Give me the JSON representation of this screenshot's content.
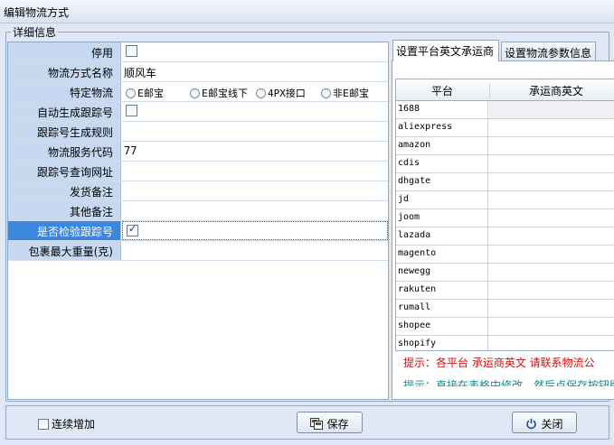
{
  "window": {
    "title": "编辑物流方式"
  },
  "group": {
    "legend": "详细信息"
  },
  "form": {
    "rows": [
      {
        "label": "停用"
      },
      {
        "label": "物流方式名称",
        "value": "顺风车"
      },
      {
        "label": "特定物流",
        "options": [
          "E邮宝",
          "E邮宝线下",
          "4PX接口",
          "非E邮宝"
        ]
      },
      {
        "label": "自动生成跟踪号"
      },
      {
        "label": "跟踪号生成规则",
        "value": ""
      },
      {
        "label": "物流服务代码",
        "value": "77"
      },
      {
        "label": "跟踪号查询网址",
        "value": ""
      },
      {
        "label": "发货备注",
        "value": ""
      },
      {
        "label": "其他备注",
        "value": ""
      },
      {
        "label": "是否检验跟踪号"
      },
      {
        "label": "包裹最大重量(克)",
        "value": ""
      }
    ]
  },
  "tabs": [
    {
      "label": "设置平台英文承运商",
      "active": true
    },
    {
      "label": "设置物流参数信息",
      "active": false
    }
  ],
  "grid": {
    "headers": [
      "平台",
      "承运商英文"
    ],
    "rows": [
      "1688",
      "aliexpress",
      "amazon",
      "cdis",
      "dhgate",
      "jd",
      "joom",
      "lazada",
      "magento",
      "newegg",
      "rakuten",
      "rumall",
      "shopee",
      "shopify"
    ]
  },
  "hints": {
    "red": "提示：各平台 承运商英文 请联系物流公",
    "teal": "提示：直接在表格中修改，然后点保存按钮即"
  },
  "footer": {
    "continuous_label": "连续增加",
    "save_label": "保存",
    "close_label": "关闭"
  },
  "colors": {
    "label_bg": "#c6d9f1",
    "selected_row": "#3d86e0",
    "hint_red": "#d01010",
    "hint_teal": "#1b8a8a"
  }
}
